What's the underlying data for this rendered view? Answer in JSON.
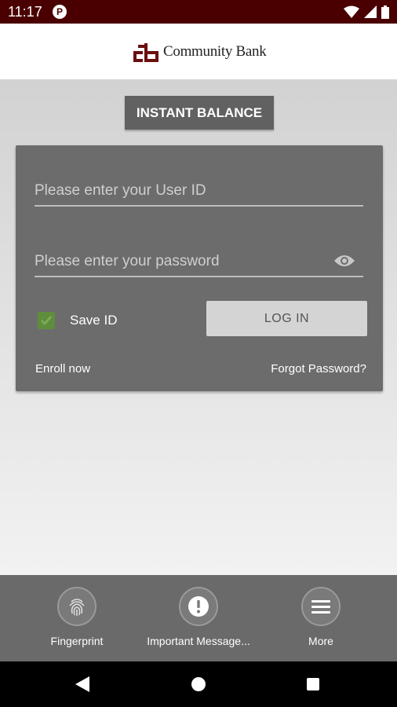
{
  "status_bar": {
    "time": "11:17",
    "app_icon_letter": "P"
  },
  "header": {
    "logo_text": "Community Bank",
    "brand_color": "#6b0f0f"
  },
  "instant_balance": {
    "label": "INSTANT BALANCE"
  },
  "login": {
    "user_id_placeholder": "Please enter your User ID",
    "password_placeholder": "Please enter your password",
    "save_id_label": "Save ID",
    "save_id_checked": true,
    "login_label": "LOG IN",
    "enroll_label": "Enroll now",
    "forgot_label": "Forgot Password?"
  },
  "bottom_nav": {
    "items": [
      {
        "label": "Fingerprint",
        "icon": "fingerprint-icon"
      },
      {
        "label": "Important Message...",
        "icon": "exclamation-icon"
      },
      {
        "label": "More",
        "icon": "menu-icon"
      }
    ]
  },
  "colors": {
    "status_bar": "#4a0000",
    "checkbox": "#5f8d3e",
    "card": "#6c6c6c"
  }
}
